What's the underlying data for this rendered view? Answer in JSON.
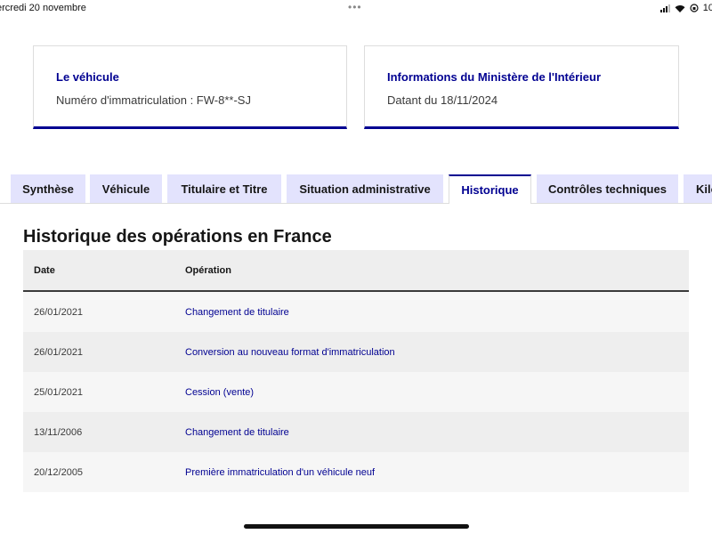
{
  "status_bar": {
    "date": "ercredi 20 novembre",
    "battery": "10"
  },
  "cards": {
    "vehicle": {
      "title": "Le véhicule",
      "text": "Numéro d'immatriculation : FW-8**-SJ"
    },
    "ministry": {
      "title": "Informations du Ministère de l'Intérieur",
      "text": "Datant du 18/11/2024"
    }
  },
  "tabs": [
    {
      "label": "Synthèse"
    },
    {
      "label": "Véhicule"
    },
    {
      "label": "Titulaire et Titre"
    },
    {
      "label": "Situation administrative"
    },
    {
      "label": "Historique",
      "active": true
    },
    {
      "label": "Contrôles techniques"
    },
    {
      "label": "Kilo"
    }
  ],
  "history": {
    "title": "Historique des opérations en France",
    "headers": {
      "date": "Date",
      "operation": "Opération"
    },
    "rows": [
      {
        "date": "26/01/2021",
        "operation": "Changement de titulaire"
      },
      {
        "date": "26/01/2021",
        "operation": "Conversion au nouveau format d'immatriculation"
      },
      {
        "date": "25/01/2021",
        "operation": "Cession (vente)"
      },
      {
        "date": "13/11/2006",
        "operation": "Changement de titulaire"
      },
      {
        "date": "20/12/2005",
        "operation": "Première immatriculation d'un véhicule neuf"
      }
    ]
  },
  "colors": {
    "accent": "#000091",
    "tab_background": "#e3e3fd"
  }
}
